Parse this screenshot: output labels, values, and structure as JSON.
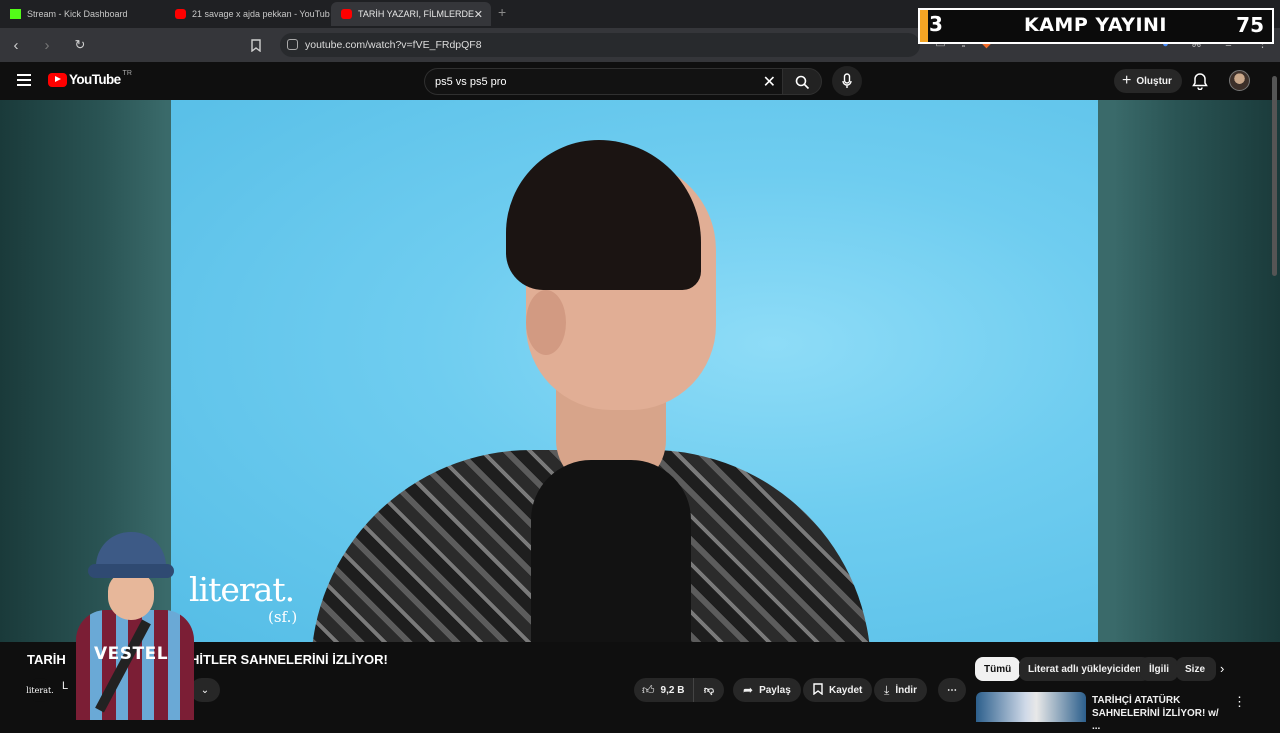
{
  "browser": {
    "tabs": [
      {
        "label": "Stream - Kick Dashboard",
        "active": false
      },
      {
        "label": "21 savage x ajda pekkan - YouTube",
        "active": false
      },
      {
        "label": "TARİH YAZARI, FİLMLERDE",
        "active": true
      }
    ],
    "url": "youtube.com/watch?v=fVE_FRdpQF8"
  },
  "overlay": {
    "left_number": "3",
    "title": "KAMP YAYINI",
    "right_number": "75"
  },
  "youtube": {
    "logo_text": "YouTube",
    "country_code": "TR",
    "search_value": "ps5 vs ps5 pro",
    "create_label": "Oluştur"
  },
  "video": {
    "watermark": "literat.",
    "watermark_sub": "(sf.)",
    "title": "TARİH",
    "title_rest": "Kİ HİTLER SAHNELERİNİ İZLİYOR!",
    "channel_logo": "literat.",
    "channel_prefix": "L",
    "likes": "9,2 B",
    "share_label": "Paylaş",
    "save_label": "Kaydet",
    "download_label": "İndir"
  },
  "streamer_overlay": {
    "shirt_text": "VESTEL"
  },
  "sidebar": {
    "chips": [
      "Tümü",
      "Literat adlı yükleyiciden",
      "İlgili",
      "Size"
    ],
    "rec_title_line1": "TARİHÇİ ATATÜRK",
    "rec_title_line2": "SAHNELERİNİ İZLİYOR! w/ ..."
  },
  "colors": {
    "brand_red": "#ff0000",
    "overlay_accent": "#f5a524",
    "background": "#0f0f0f",
    "video_bg": "#6fcdf0"
  }
}
